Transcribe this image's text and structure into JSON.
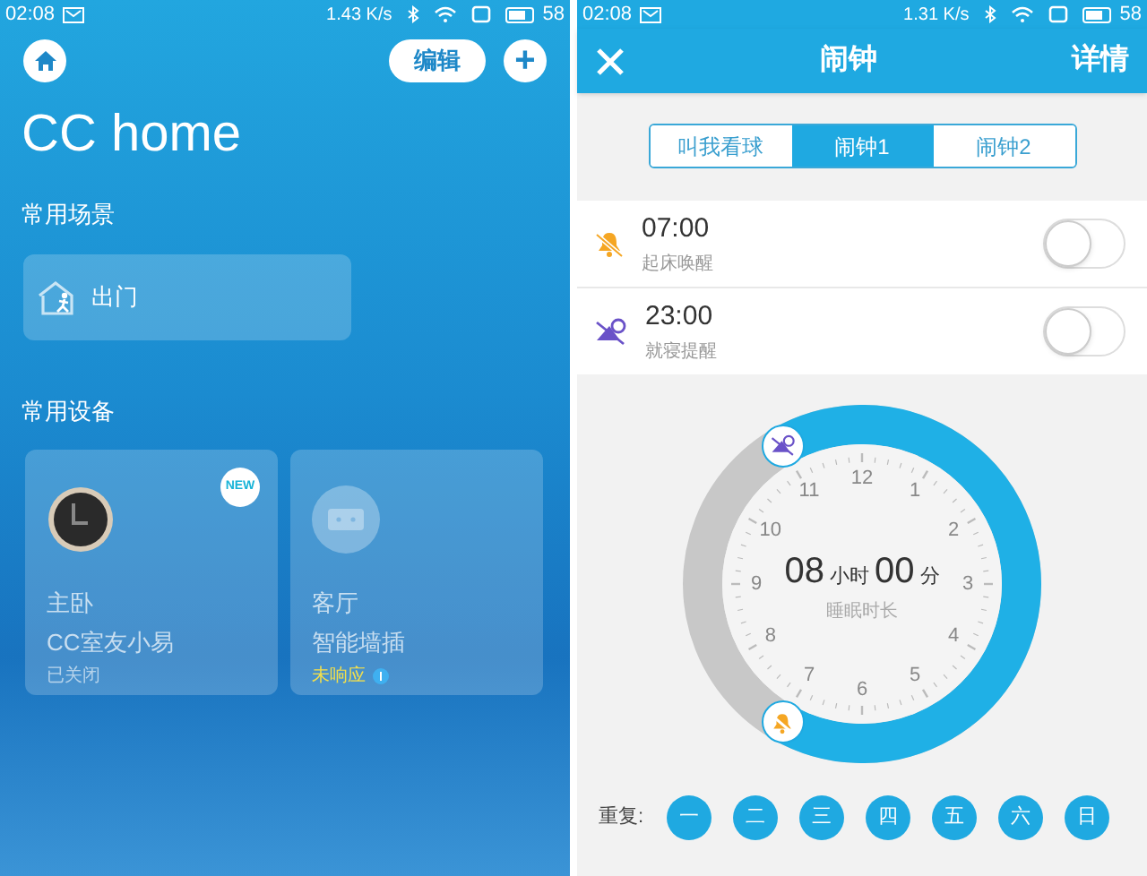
{
  "left_screen": {
    "status_bar": {
      "time": "02:08",
      "speed": "1.43 K/s",
      "battery": "58"
    },
    "edit_button": "编辑",
    "add_button": "+",
    "title": "CC home",
    "scenes_heading": "常用场景",
    "scenes": [
      {
        "label": "出门"
      }
    ],
    "devices_heading": "常用设备",
    "devices": [
      {
        "kind": "clock",
        "room": "主卧",
        "name": "CC室友小易",
        "status": "已关闭",
        "badge": "NEW",
        "warning": false
      },
      {
        "kind": "plug",
        "room": "客厅",
        "name": "智能墙插",
        "status": "未响应",
        "warning": true
      }
    ]
  },
  "right_screen": {
    "status_bar": {
      "time": "02:08",
      "speed": "1.31 K/s",
      "battery": "58"
    },
    "title": "闹钟",
    "details_button": "详情",
    "tabs": [
      {
        "label": "叫我看球",
        "selected": false
      },
      {
        "label": "闹钟1",
        "selected": true
      },
      {
        "label": "闹钟2",
        "selected": false
      }
    ],
    "alarms": [
      {
        "kind": "wake",
        "time": "07:00",
        "label": "起床唤醒",
        "on": false
      },
      {
        "kind": "sleep",
        "time": "23:00",
        "label": "就寝提醒",
        "on": false
      }
    ],
    "dial": {
      "hours": "08",
      "hours_unit": "小时",
      "minutes": "00",
      "minutes_unit": "分",
      "caption": "睡眠时长",
      "numbers": [
        "12",
        "1",
        "2",
        "3",
        "4",
        "5",
        "6",
        "7",
        "8",
        "9",
        "10",
        "11"
      ]
    },
    "repeat_label": "重复:",
    "days": [
      {
        "label": "一",
        "selected": true
      },
      {
        "label": "二",
        "selected": true
      },
      {
        "label": "三",
        "selected": true
      },
      {
        "label": "四",
        "selected": true
      },
      {
        "label": "五",
        "selected": true
      },
      {
        "label": "六",
        "selected": true
      },
      {
        "label": "日",
        "selected": true
      }
    ]
  }
}
